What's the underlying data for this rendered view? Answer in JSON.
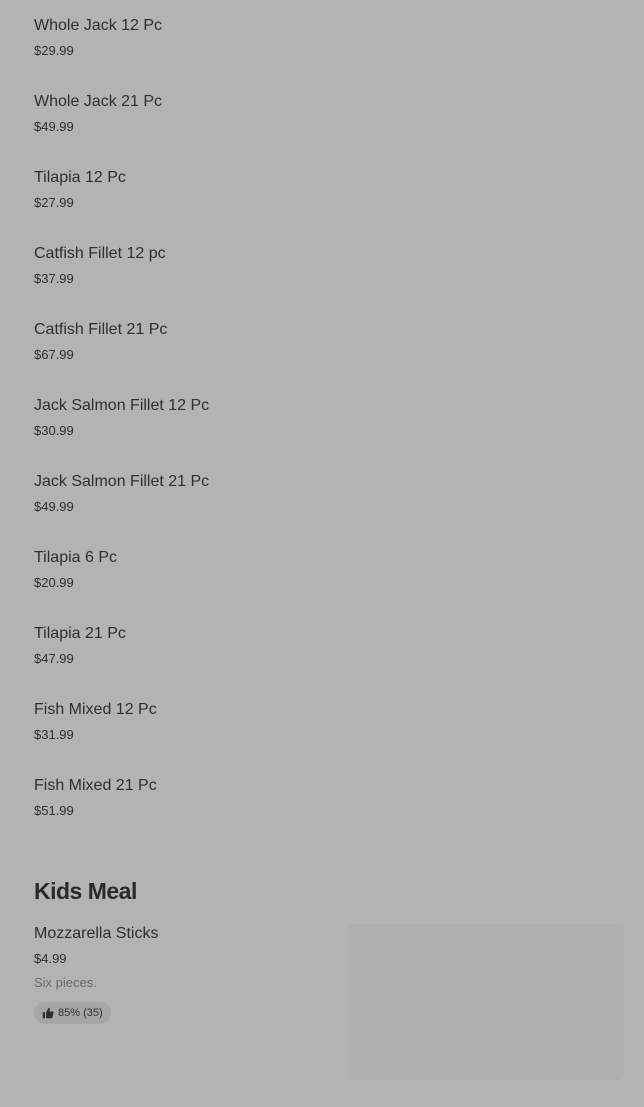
{
  "menu": {
    "items": [
      {
        "name": "Whole Jack 12 Pc",
        "price": "$29.99"
      },
      {
        "name": "Whole Jack 21 Pc",
        "price": "$49.99"
      },
      {
        "name": "Tilapia 12 Pc",
        "price": "$27.99"
      },
      {
        "name": "Catfish Fillet 12 pc",
        "price": "$37.99"
      },
      {
        "name": "Catfish Fillet 21 Pc",
        "price": "$67.99"
      },
      {
        "name": "Jack Salmon Fillet 12 Pc",
        "price": "$30.99"
      },
      {
        "name": "Jack Salmon Fillet 21 Pc",
        "price": "$49.99"
      },
      {
        "name": "Tilapia 6 Pc",
        "price": "$20.99"
      },
      {
        "name": "Tilapia 21 Pc",
        "price": "$47.99"
      },
      {
        "name": "Fish Mixed 12 Pc",
        "price": "$31.99"
      },
      {
        "name": "Fish Mixed 21 Pc",
        "price": "$51.99"
      }
    ]
  },
  "kids_meal": {
    "title": "Kids Meal",
    "item": {
      "name": "Mozzarella Sticks",
      "price": "$4.99",
      "description": "Six pieces.",
      "rating": "85% (35)",
      "rating_icon": "thumbs-up-icon"
    }
  },
  "colors": {
    "background": "#b3b3b3",
    "text": "#2f2f2f",
    "muted_text": "#6b6b6b",
    "badge_bg": "#a6a6a6"
  }
}
